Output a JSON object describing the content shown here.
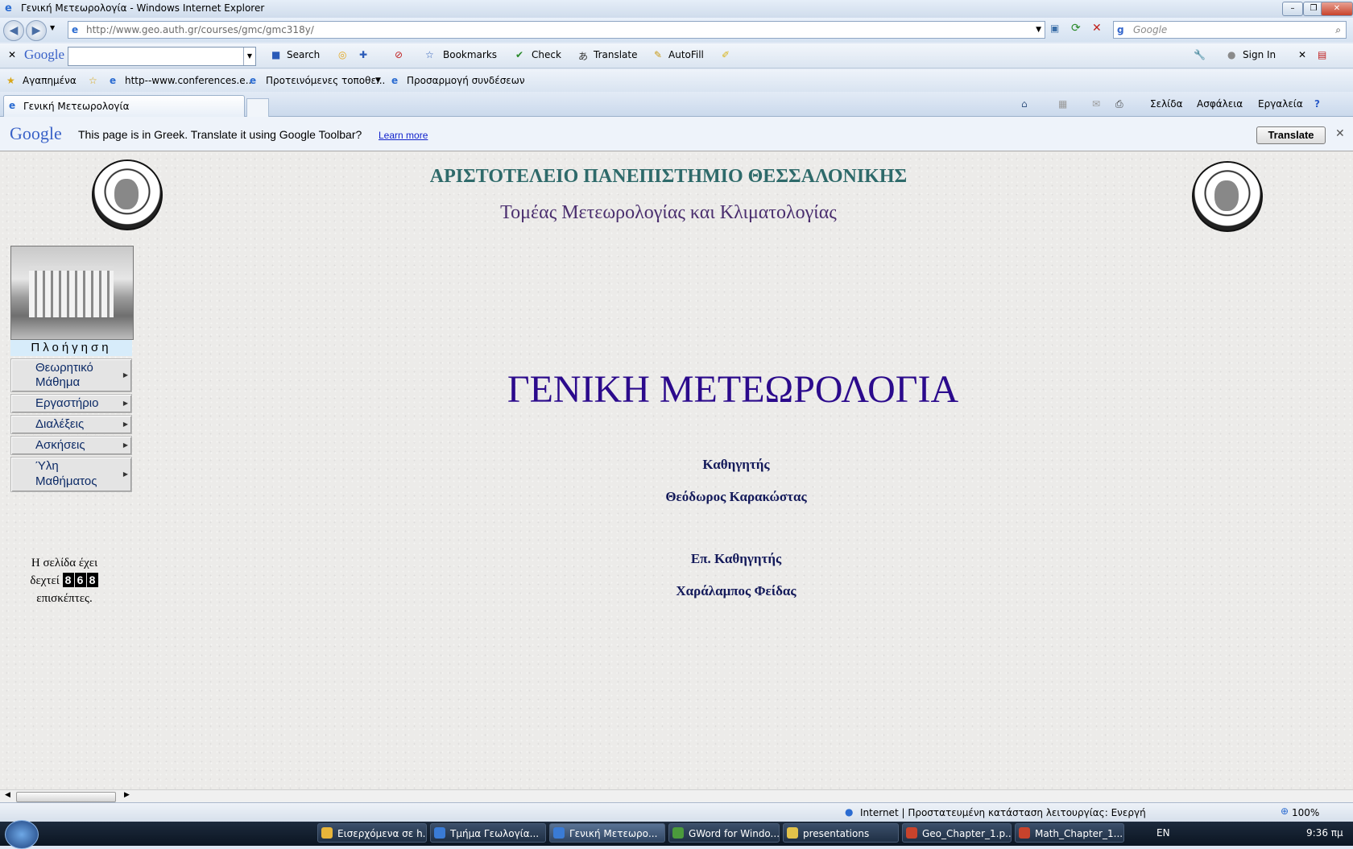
{
  "window": {
    "title": "Γενική Μετεωρολογία - Windows Internet Explorer",
    "url": "http://www.geo.auth.gr/courses/gmc/gmc318y/",
    "search_placeholder": "Google"
  },
  "google_toolbar": {
    "logo": "Google",
    "search_label": "Search",
    "bookmarks_label": "Bookmarks",
    "check_label": "Check",
    "translate_label": "Translate",
    "autofill_label": "AutoFill",
    "signin_label": "Sign In"
  },
  "favorites": {
    "favorites_label": "Αγαπημένα",
    "items": [
      "http--www.conferences.e...",
      "Προτεινόμενες τοποθε...",
      "Προσαρμογή συνδέσεων"
    ]
  },
  "tabs": [
    {
      "label": "Γενική Μετεωρολογία"
    }
  ],
  "commands": {
    "page": "Σελίδα",
    "safety": "Ασφάλεια",
    "tools": "Εργαλεία"
  },
  "translate_bar": {
    "logo": "Google",
    "message": "This page is in Greek.  Translate it using Google Toolbar?",
    "learn_more": "Learn more",
    "button": "Translate"
  },
  "page": {
    "university": "ΑΡΙΣΤΟΤΕΛΕΙΟ ΠΑΝΕΠΙΣΤΗΜΙΟ ΘΕΣΣΑΛΟΝΙΚΗΣ",
    "department": "Τομέας Μετεωρολογίας και Κλιματολογίας",
    "course_title": "ΓΕΝΙΚΗ ΜΕΤΕΩΡΟΛΟΓΙΑ",
    "role1": "Καθηγητής",
    "person1": "Θεόδωρος Καρακώστας",
    "role2": "Επ. Καθηγητής",
    "person2": "Χαράλαμπος Φείδας",
    "nav_header": "Πλοήγηση",
    "nav_items": [
      {
        "line1": "Θεωρητικό",
        "line2": "Μάθημα"
      },
      {
        "line1": "Εργαστήριο",
        "line2": ""
      },
      {
        "line1": "Διαλέξεις",
        "line2": ""
      },
      {
        "line1": "Ασκήσεις",
        "line2": ""
      },
      {
        "line1": "Ύλη",
        "line2": "Μαθήματος"
      }
    ],
    "counter_prefix": "Η σελίδα έχει",
    "counter_mid": "δεχτεί",
    "counter_digits": [
      "8",
      "6",
      "8"
    ],
    "counter_suffix": "επισκέπτες."
  },
  "status": {
    "zone": "Internet | Προστατευμένη κατάσταση λειτουργίας: Ενεργή",
    "zoom": "100%"
  },
  "taskbar": {
    "items": [
      "Εισερχόμενα σε h...",
      "Τμήμα Γεωλογία...",
      "Γενική Μετεωρο...",
      "GWord for Windo...",
      "presentations",
      "Geo_Chapter_1.p...",
      "Math_Chapter_1..."
    ],
    "lang": "EN",
    "time": "9:36 πμ"
  },
  "colors": {
    "title_blue": "#2b0a8c",
    "heading_teal": "#2e6a6a",
    "dept_purple": "#4a2e6e",
    "names_navy": "#141a5a"
  }
}
